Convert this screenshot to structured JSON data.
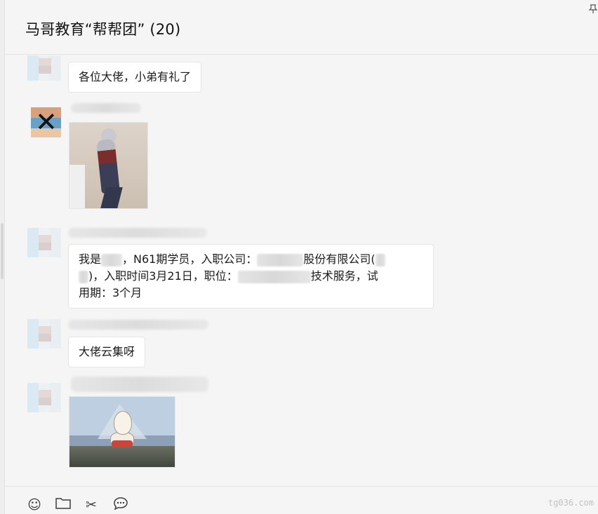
{
  "header": {
    "title": "马哥教育“帮帮团” (20)",
    "pin_icon": "pin-icon"
  },
  "messages": [
    {
      "type": "text",
      "text": "各位大佬，小弟有礼了"
    },
    {
      "type": "image",
      "image_desc": "ultraman-figure-photo"
    },
    {
      "type": "text",
      "line1_a": "我是",
      "line1_b": "，N61期学员，入职公司：",
      "line1_c": "股份有限公司(",
      "line2_a": ")，入职时间3月21日，职位：",
      "line2_b": "技术服务，试",
      "line3": "用期：3个月"
    },
    {
      "type": "text",
      "text": "大佬云集呀"
    },
    {
      "type": "image",
      "image_desc": "cartoon-sticker"
    }
  ],
  "toolbar": {
    "emoji_glyph": "☺",
    "folder_glyph": "▭",
    "scissors_glyph": "✂",
    "chat_glyph": "…"
  },
  "watermark": "tg036.com",
  "colors": {
    "background": "#f5f5f5",
    "bubble": "#ffffff",
    "border": "#e6e6e6"
  }
}
